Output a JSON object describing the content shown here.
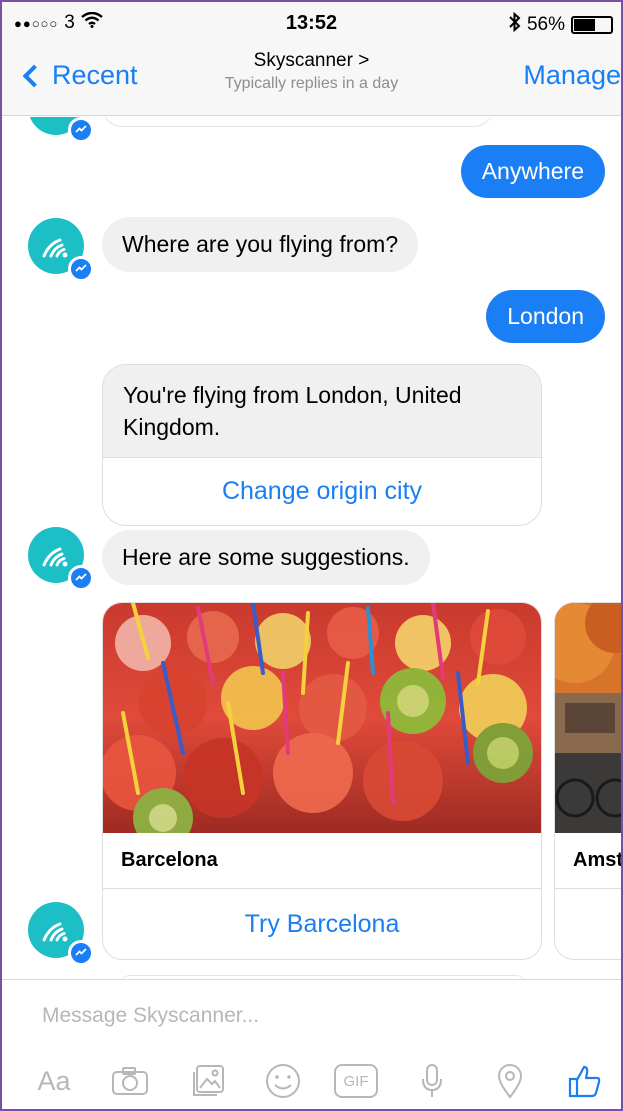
{
  "status_bar": {
    "carrier": "3",
    "signal": "●●○○○",
    "time": "13:52",
    "battery_percent": "56%",
    "battery_level": 0.56
  },
  "nav": {
    "back_label": "Recent",
    "title": "Skyscanner >",
    "subtitle": "Typically replies in a day",
    "manage_label": "Manage"
  },
  "messages": {
    "user_anywhere": "Anywhere",
    "bot_where_from": "Where are you flying from?",
    "user_london": "London",
    "bot_flying_from": "You're flying from London, United Kingdom.",
    "change_origin": "Change origin city",
    "bot_suggestions": "Here are some suggestions."
  },
  "destinations": [
    {
      "name": "Barcelona",
      "action": "Try Barcelona"
    },
    {
      "name": "Amst",
      "action": ""
    }
  ],
  "composer": {
    "placeholder": "Message Skyscanner...",
    "text_tool_label": "Aa",
    "gif_label": "GIF"
  },
  "colors": {
    "accent": "#1a7ef5",
    "bot_avatar": "#1bbfc5",
    "incoming_bubble": "#f0f0f0"
  }
}
